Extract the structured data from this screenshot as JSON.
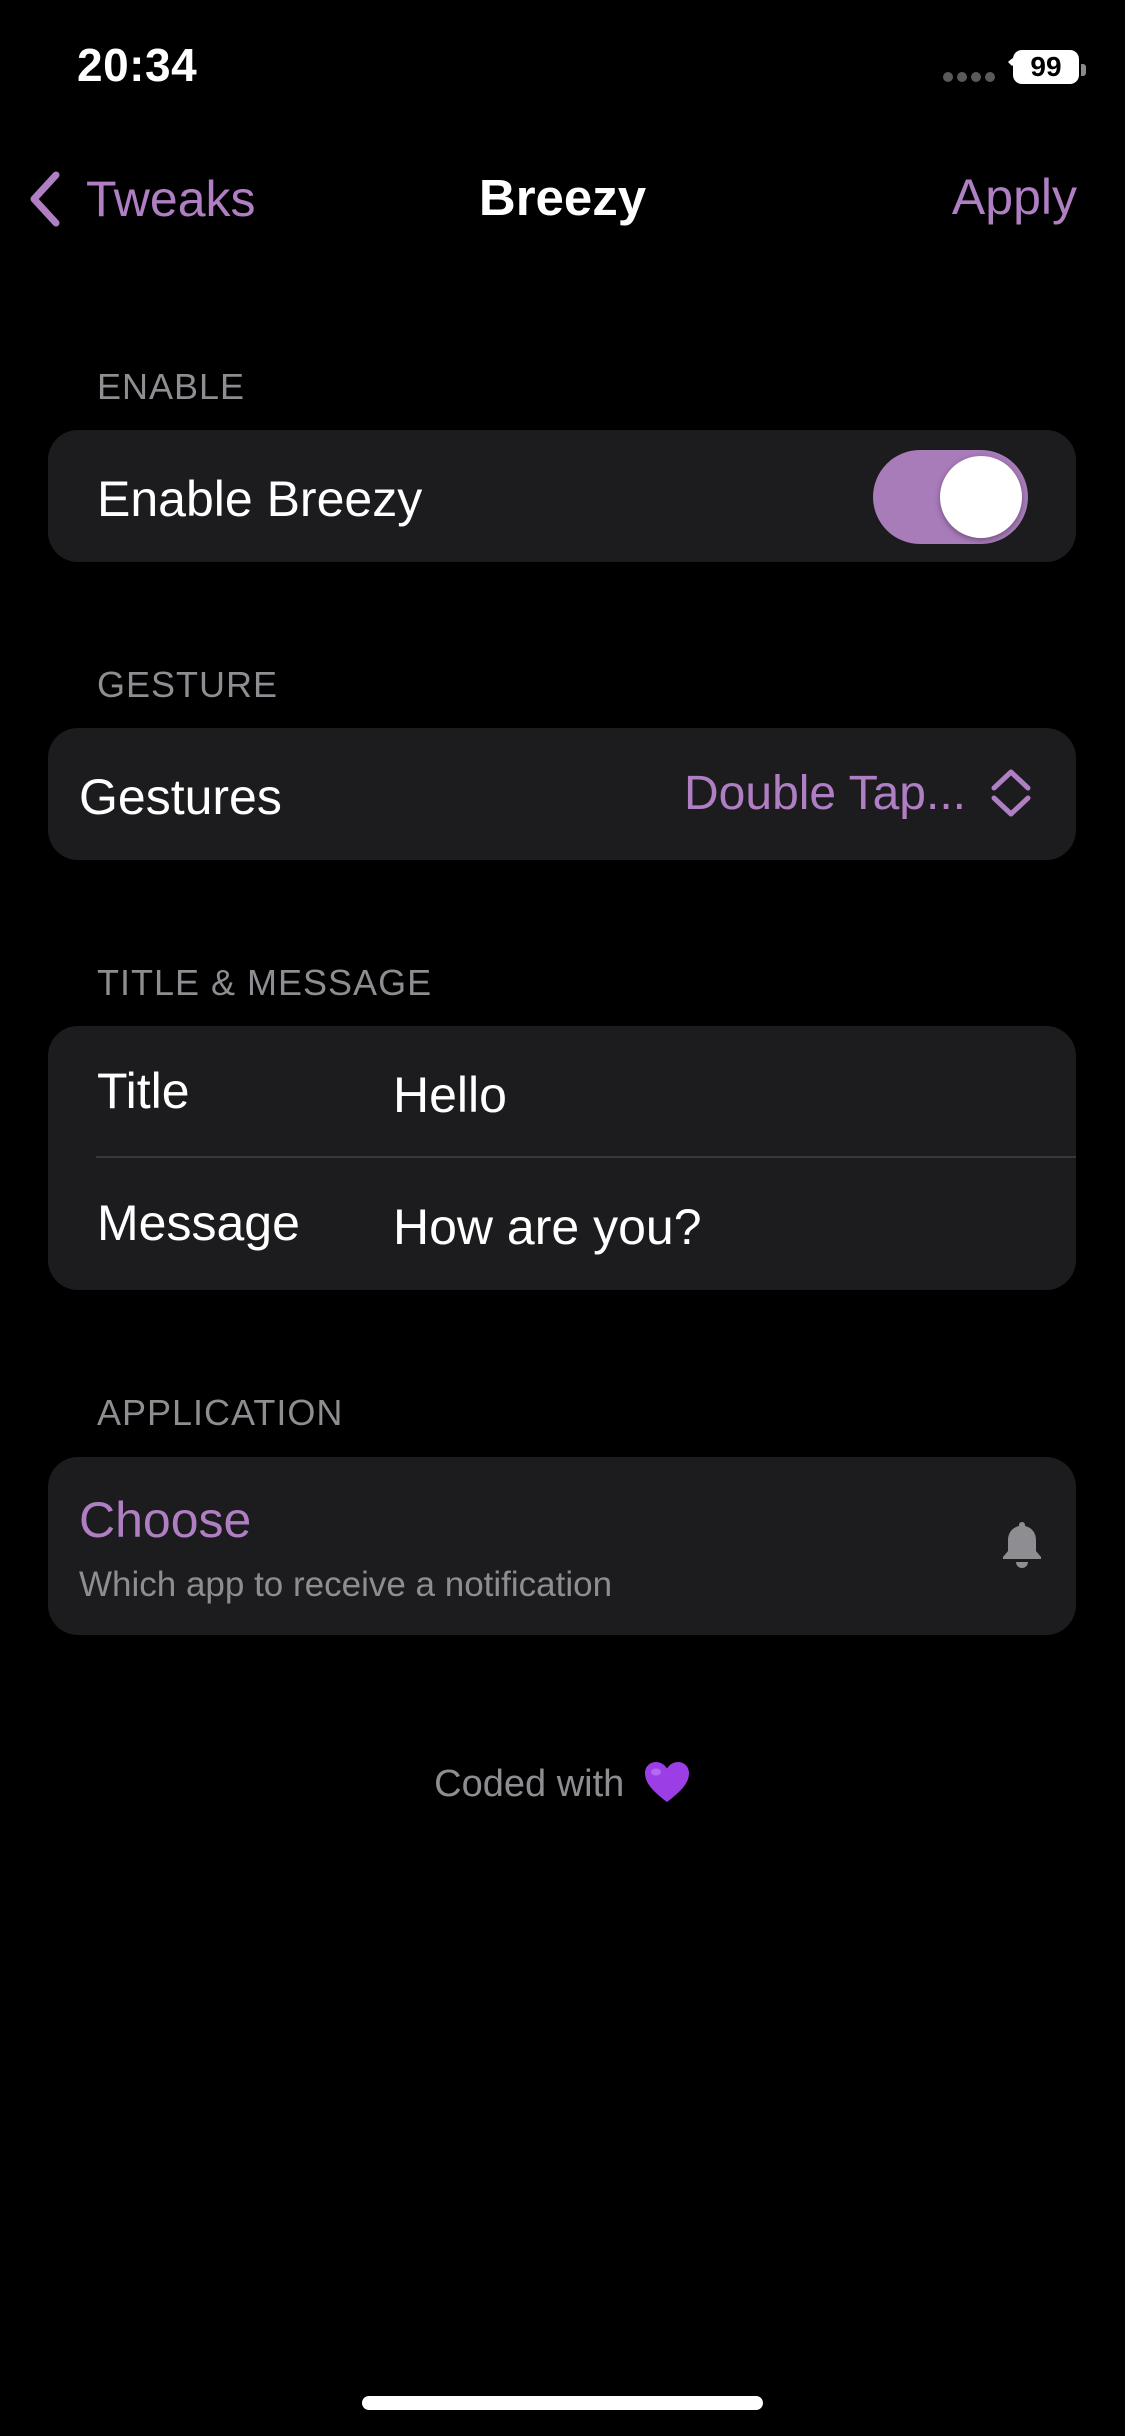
{
  "status_bar": {
    "time": "20:34",
    "battery": "99",
    "icons": [
      "signal-icon",
      "wifi-icon",
      "battery-icon"
    ]
  },
  "nav": {
    "back_label": "Tweaks",
    "title": "Breezy",
    "apply_label": "Apply"
  },
  "sections": {
    "enable": {
      "header": "ENABLE",
      "label": "Enable Breezy",
      "toggle_on": true
    },
    "gesture": {
      "header": "GESTURE",
      "label": "Gestures",
      "value": "Double Tap..."
    },
    "title_message": {
      "header": "TITLE & MESSAGE",
      "title_label": "Title",
      "title_value": "Hello",
      "message_label": "Message",
      "message_value": "How are you?"
    },
    "application": {
      "header": "APPLICATION",
      "choose_label": "Choose",
      "choose_subtitle": "Which app to receive a notification",
      "icon": "bell-icon"
    }
  },
  "footer": {
    "text": "Coded with",
    "icon": "purple-heart-icon"
  },
  "colors": {
    "accent": "#b07fc3",
    "toggle_on": "#a87bb9",
    "cell_background": "#1c1c1e",
    "background": "#000000",
    "secondary_text": "#8d8d92"
  }
}
